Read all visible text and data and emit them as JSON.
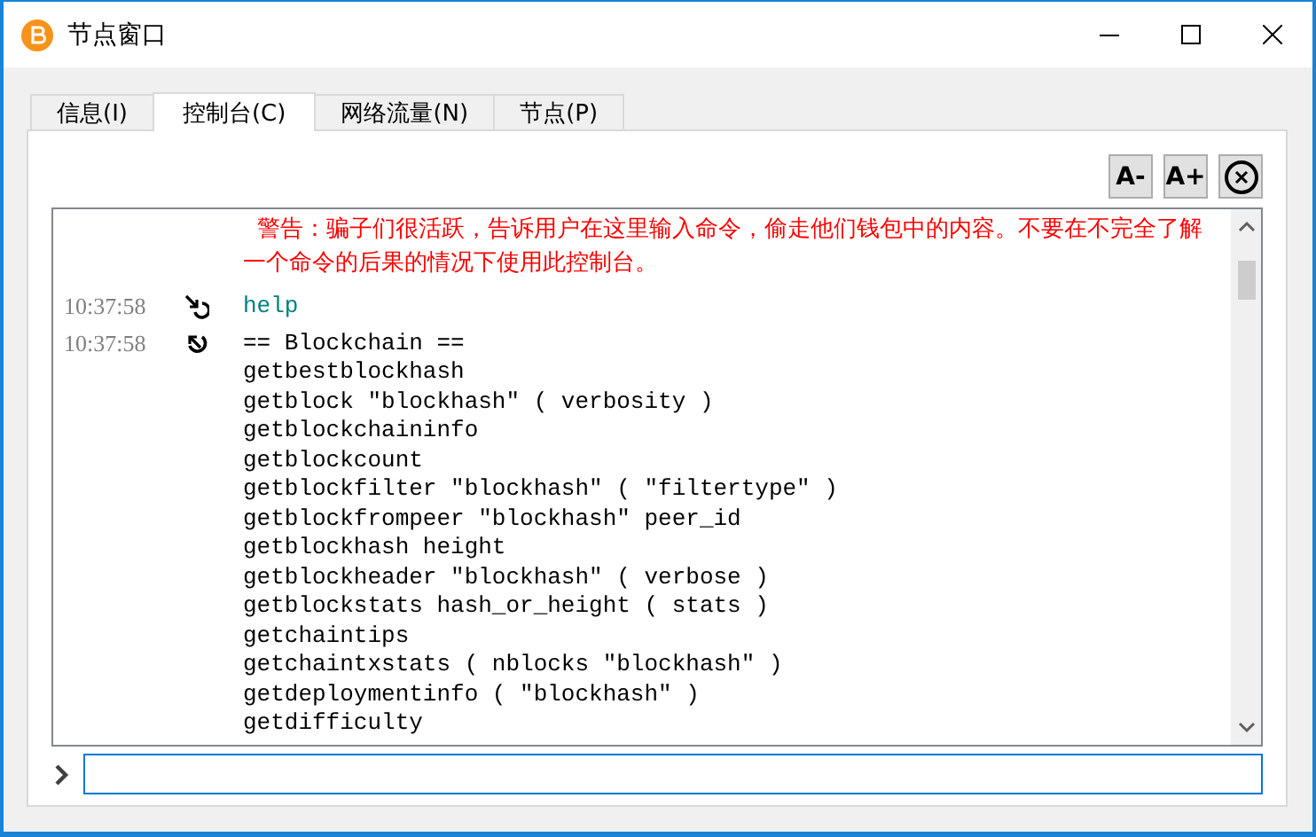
{
  "window": {
    "title": "节点窗口"
  },
  "tabs": [
    {
      "label": "信息(I)",
      "selected": false
    },
    {
      "label": "控制台(C)",
      "selected": true
    },
    {
      "label": "网络流量(N)",
      "selected": false
    },
    {
      "label": "节点(P)",
      "selected": false
    }
  ],
  "toolbar": {
    "buttons": [
      "A-",
      "A+"
    ]
  },
  "console": {
    "warning": "警告：骗子们很活跃，告诉用户在这里输入命令，偷走他们钱包中的内容。不要在不完全了解一个命令的后果的情况下使用此控制台。",
    "entries": [
      {
        "time": "10:37:58",
        "kind": "request",
        "lines": [
          "help"
        ]
      },
      {
        "time": "10:37:58",
        "kind": "reply",
        "lines": [
          "== Blockchain ==",
          "getbestblockhash",
          "getblock \"blockhash\" ( verbosity )",
          "getblockchaininfo",
          "getblockcount",
          "getblockfilter \"blockhash\" ( \"filtertype\" )",
          "getblockfrompeer \"blockhash\" peer_id",
          "getblockhash height",
          "getblockheader \"blockhash\" ( verbose )",
          "getblockstats hash_or_height ( stats )",
          "getchaintips",
          "getchaintxstats ( nblocks \"blockhash\" )",
          "getdeploymentinfo ( \"blockhash\" )",
          "getdifficulty"
        ]
      }
    ]
  }
}
